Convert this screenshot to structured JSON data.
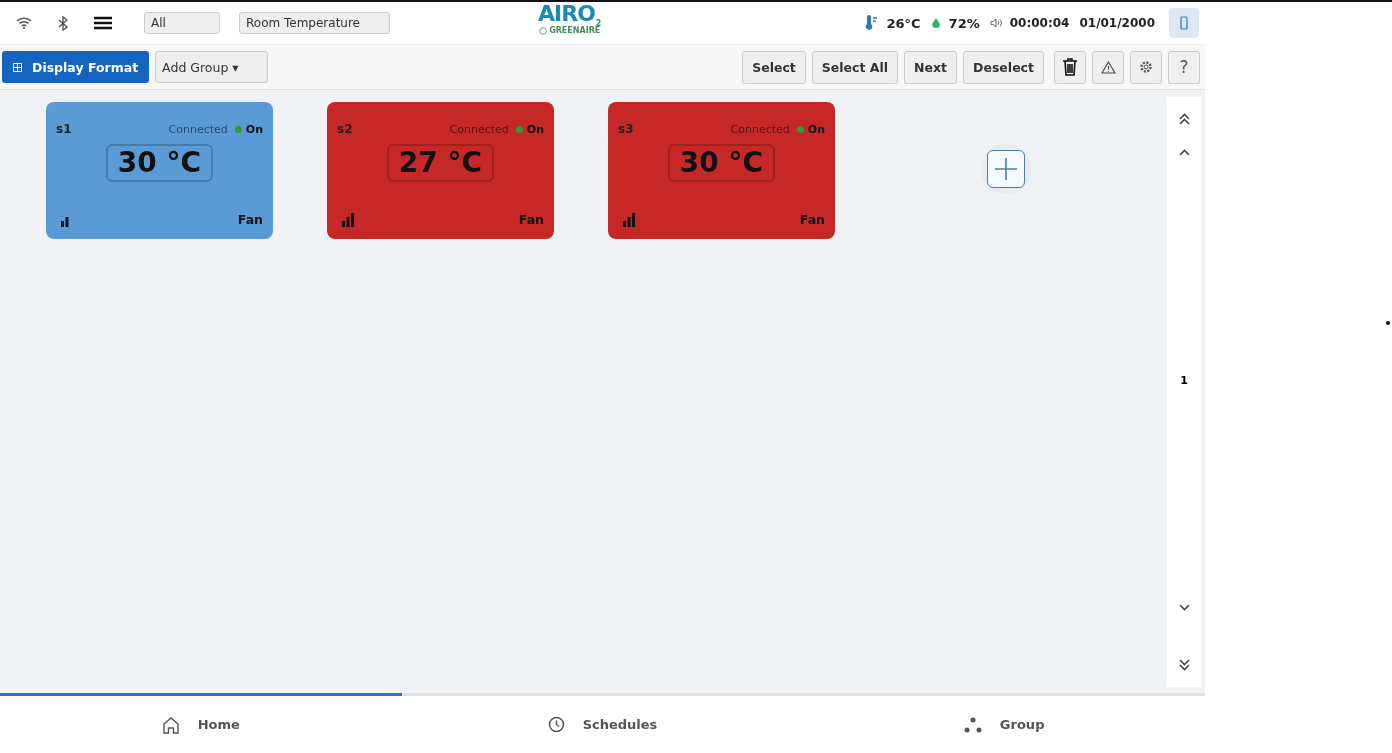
{
  "header": {
    "filter": "All",
    "sensor_type": "Room Temperature",
    "logo": {
      "title": "AIRO",
      "mark": "2",
      "tagline": "GREENAIRE"
    },
    "temperature": "26°C",
    "humidity": "72%",
    "time": "00:00:04",
    "date": "01/01/2000"
  },
  "toolbar": {
    "display_format": "Display Format",
    "add_group": "Add Group ▾",
    "buttons": [
      "Select",
      "Select All",
      "Next",
      "Deselect"
    ],
    "help": "?"
  },
  "sensors": [
    {
      "name": "s1",
      "status": "Connected",
      "on": true,
      "state": "On",
      "reading": "30 °C",
      "strong_signal": false,
      "mode": "Fan",
      "color": "#5b9bd5"
    },
    {
      "name": "s2",
      "status": "Connected",
      "on": true,
      "state": "On",
      "reading": "27 °C",
      "strong_signal": true,
      "mode": "Fan",
      "color": "#c62828"
    },
    {
      "name": "s3",
      "status": "Connected",
      "on": true,
      "state": "On",
      "reading": "30 °C",
      "strong_signal": true,
      "mode": "Fan",
      "color": "#c62828"
    }
  ],
  "pager": {
    "page": "1"
  },
  "nav": [
    {
      "label": "Home",
      "selected": true
    },
    {
      "label": "Schedules",
      "selected": false
    },
    {
      "label": "Group",
      "selected": false
    }
  ]
}
